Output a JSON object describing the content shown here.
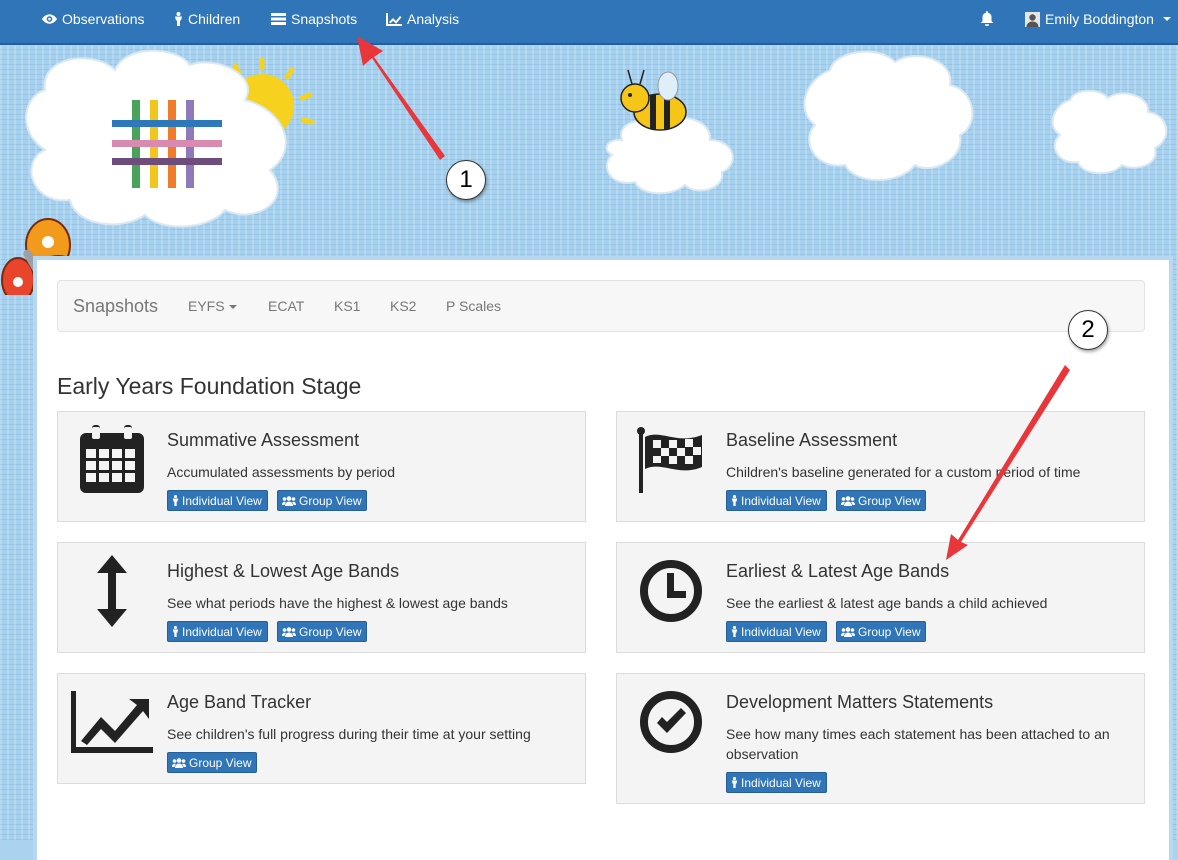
{
  "navbar": {
    "items": [
      {
        "label": "Observations",
        "icon": "eye-icon"
      },
      {
        "label": "Children",
        "icon": "child-icon"
      },
      {
        "label": "Snapshots",
        "icon": "list-icon"
      },
      {
        "label": "Analysis",
        "icon": "chart-line-icon"
      }
    ],
    "user_name": "Emily Boddington",
    "colors": {
      "bar": "#2f75b8"
    }
  },
  "subnav": {
    "brand": "Snapshots",
    "links": [
      "EYFS",
      "ECAT",
      "KS1",
      "KS2",
      "P Scales"
    ]
  },
  "page_title": "Early Years Foundation Stage",
  "cards": [
    {
      "title": "Summative Assessment",
      "desc": "Accumulated assessments by period",
      "icon": "calendar-icon",
      "buttons": [
        "Individual View",
        "Group View"
      ]
    },
    {
      "title": "Baseline Assessment",
      "desc": "Children's baseline generated for a custom period of time",
      "icon": "checkered-flag-icon",
      "buttons": [
        "Individual View",
        "Group View"
      ]
    },
    {
      "title": "Highest & Lowest Age Bands",
      "desc": "See what periods have the highest & lowest age bands",
      "icon": "vertical-arrows-icon",
      "buttons": [
        "Individual View",
        "Group View"
      ]
    },
    {
      "title": "Earliest & Latest Age Bands",
      "desc": "See the earliest & latest age bands a child achieved",
      "icon": "clock-icon",
      "buttons": [
        "Individual View",
        "Group View"
      ]
    },
    {
      "title": "Age Band Tracker",
      "desc": "See children's full progress during their time at your setting",
      "icon": "line-chart-icon",
      "buttons": [
        "Group View"
      ]
    },
    {
      "title": "Development Matters Statements",
      "desc": "See how many times each statement has been attached to an observation",
      "icon": "check-circle-icon",
      "buttons": [
        "Individual View"
      ]
    }
  ],
  "annotations": {
    "callout_1": "1",
    "callout_2": "2"
  }
}
